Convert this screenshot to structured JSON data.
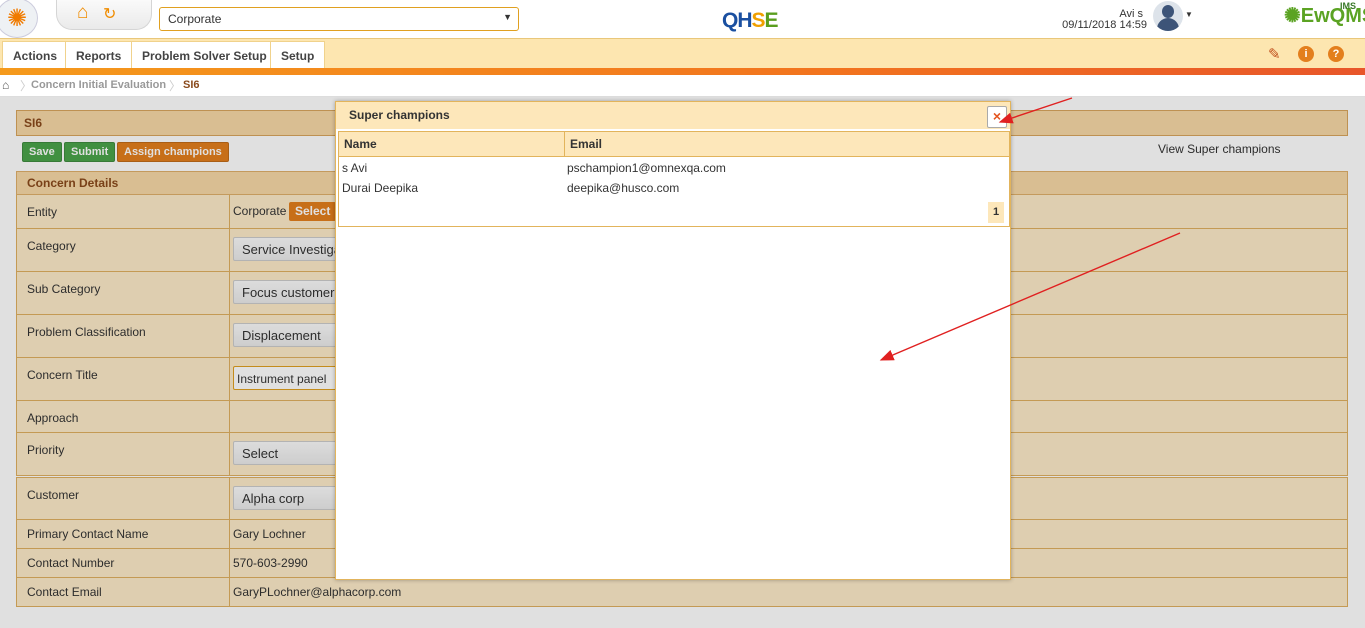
{
  "header": {
    "entity_select": "Corporate",
    "brand": {
      "q": "Q",
      "h": "H",
      "s": "S",
      "e": "E"
    },
    "user_name": "Avi s",
    "datetime": "09/11/2018 14:59",
    "product_logo": "EwQMS",
    "product_logo_super": "IMS"
  },
  "menu": {
    "items": [
      "Actions",
      "Reports",
      "Problem Solver Setup",
      "Setup"
    ],
    "icons": [
      "pin-icon",
      "info-icon",
      "help-icon"
    ]
  },
  "breadcrumb": [
    "Concern Initial Evaluation",
    "SI6"
  ],
  "form": {
    "title": "SI6",
    "buttons": {
      "save": "Save",
      "submit": "Submit",
      "assign": "Assign champions"
    },
    "view_super": "View Super champions",
    "section_title": "Concern Details",
    "rows": [
      {
        "label": "Entity",
        "value": "Corporate",
        "action": "Select"
      },
      {
        "label": "Category",
        "value": "Service Investigation"
      },
      {
        "label": "Sub Category",
        "value": "Focus customer"
      },
      {
        "label": "Problem Classification",
        "value": "Displacement"
      },
      {
        "label": "Concern Title",
        "value": "Instrument panel"
      },
      {
        "label": "Approach",
        "value": ""
      },
      {
        "label": "Priority",
        "value": "Select"
      },
      {
        "label": "Customer",
        "value": "Alpha corp"
      },
      {
        "label": "Primary Contact Name",
        "value": "Gary Lochner"
      },
      {
        "label": "Contact Number",
        "value": "570-603-2990"
      },
      {
        "label": "Contact Email",
        "value": "GaryPLochner@alphacorp.com"
      }
    ]
  },
  "modal": {
    "title": "Super champions",
    "close_glyph": "×",
    "columns": [
      "Name",
      "Email"
    ],
    "rows": [
      {
        "name": "s Avi",
        "email": "pschampion1@omnexqa.com"
      },
      {
        "name": "Durai Deepika",
        "email": "deepika@husco.com"
      }
    ],
    "page": "1"
  },
  "colors": {
    "accent": "#e37f1d",
    "green": "#4ba44b",
    "annotation": "#e02020"
  }
}
